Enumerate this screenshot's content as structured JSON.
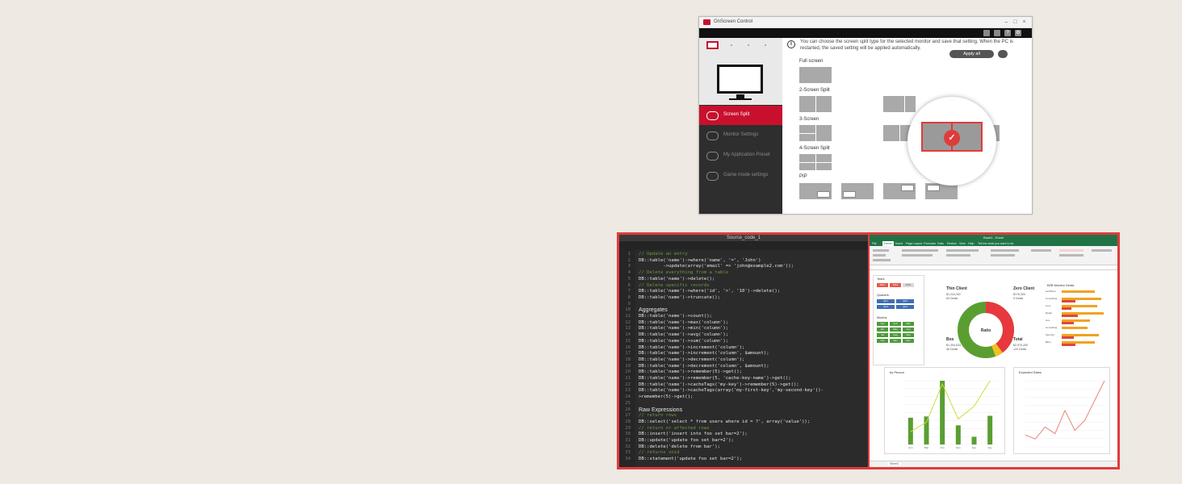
{
  "colors": {
    "lg_red": "#c8102e",
    "highlight_red": "#e03b3b",
    "excel_green": "#217346",
    "donut_green": "#5a9e32",
    "donut_red": "#e8383d",
    "bar_orange": "#f0a31f",
    "bar_red": "#e0453c",
    "line_yellow": "#cddc39"
  },
  "osc": {
    "title": "OnScreen Control",
    "toolbar_icons": [
      "cursor-icon",
      "display-icon",
      "help-icon",
      "gear-icon"
    ],
    "sidebar": [
      {
        "label": "Screen Split",
        "icon": "screen-split-icon"
      },
      {
        "label": "Monitor Settings",
        "icon": "monitor-settings-icon"
      },
      {
        "label": "My Application Preset",
        "icon": "app-preset-icon"
      },
      {
        "label": "Game mode settings",
        "icon": "gamepad-icon"
      }
    ],
    "info_text": "You can choose the screen split type for the selected monitor and save that setting. When the PC is restarted, the saved setting will be applied automatically.",
    "apply_label": "Apply all",
    "sections": {
      "full": "Full screen",
      "two": "2-Screen Split",
      "three": "3-Screen",
      "four": "4-Screen Split",
      "pip": "PIP"
    }
  },
  "code": {
    "title": "Source_code_1",
    "lines": [
      {
        "n": "1",
        "t": "// Update an entry",
        "k": "com"
      },
      {
        "n": "2",
        "t": "DB::table('name')->where('name', '=', 'John')",
        "k": "code"
      },
      {
        "n": "3",
        "t": "         ->update(array('email' => 'john@example2.com'));",
        "k": "code"
      },
      {
        "n": "4",
        "t": "// Delete everything from a table",
        "k": "com"
      },
      {
        "n": "5",
        "t": "DB::table('name')->delete();",
        "k": "code"
      },
      {
        "n": "6",
        "t": "// Delete specific records",
        "k": "com"
      },
      {
        "n": "7",
        "t": "DB::table('name')->where('id', '>', '10')->delete();",
        "k": "code"
      },
      {
        "n": "8",
        "t": "DB::table('name')->truncate();",
        "k": "code"
      },
      {
        "n": "9",
        "t": "",
        "k": "code"
      },
      {
        "n": "10",
        "t": "Aggregates",
        "k": "head"
      },
      {
        "n": "11",
        "t": "DB::table('name')->count();",
        "k": "code"
      },
      {
        "n": "12",
        "t": "DB::table('name')->max('column');",
        "k": "code"
      },
      {
        "n": "13",
        "t": "DB::table('name')->min('column');",
        "k": "code"
      },
      {
        "n": "14",
        "t": "DB::table('name')->avg('column');",
        "k": "code"
      },
      {
        "n": "15",
        "t": "DB::table('name')->sum('column');",
        "k": "code"
      },
      {
        "n": "16",
        "t": "DB::table('name')->increment('column');",
        "k": "code"
      },
      {
        "n": "17",
        "t": "DB::table('name')->increment('column', $amount);",
        "k": "code"
      },
      {
        "n": "18",
        "t": "DB::table('name')->decrement('column');",
        "k": "code"
      },
      {
        "n": "19",
        "t": "DB::table('name')->decrement('column', $amount);",
        "k": "code"
      },
      {
        "n": "20",
        "t": "DB::table('name')->remember(5)->get();",
        "k": "code"
      },
      {
        "n": "21",
        "t": "DB::table('name')->remember(5, 'cache-key-name')->get();",
        "k": "code"
      },
      {
        "n": "22",
        "t": "DB::table('name')->cacheTags('my-key')->remember(5)->get();",
        "k": "code"
      },
      {
        "n": "23",
        "t": "DB::table('name')->cacheTags(array('my-first-key','my-second-key'))-",
        "k": "code"
      },
      {
        "n": "24",
        "t": ">remember(5)->get();",
        "k": "code"
      },
      {
        "n": "25",
        "t": "",
        "k": "code"
      },
      {
        "n": "26",
        "t": "Raw Expressions",
        "k": "head"
      },
      {
        "n": "27",
        "t": "// return rows",
        "k": "com"
      },
      {
        "n": "28",
        "t": "DB::select('select * from users where id = ?', array('value'));",
        "k": "code"
      },
      {
        "n": "29",
        "t": "// return nr affected rows",
        "k": "com"
      },
      {
        "n": "30",
        "t": "DB::insert('insert into foo set bar=2');",
        "k": "code"
      },
      {
        "n": "31",
        "t": "DB::update('update foo set bar=2');",
        "k": "code"
      },
      {
        "n": "32",
        "t": "DB::delete('delete from bar');",
        "k": "code"
      },
      {
        "n": "33",
        "t": "// returns void",
        "k": "com"
      },
      {
        "n": "34",
        "t": "DB::statement('update foo set bar=2');",
        "k": "code"
      }
    ]
  },
  "excel": {
    "title": "Book1 - Excel",
    "tabs": [
      "File",
      "Home",
      "Insert",
      "Page Layout",
      "Formulas",
      "Data",
      "Review",
      "View",
      "Help",
      "Tell me what you want to do"
    ],
    "slicers": [
      {
        "title": "Years",
        "items": [
          "2011",
          "2012",
          "2013"
        ]
      },
      {
        "title": "Quarters",
        "items": [
          "Qtr1",
          "Qtr2",
          "Qtr3",
          "Qtr4"
        ]
      },
      {
        "title": "Months",
        "items": [
          "Jan",
          "Feb",
          "Mar",
          "Apr",
          "May",
          "Jun",
          "Jul",
          "Aug",
          "Sep",
          "Oct",
          "Nov",
          "Dec"
        ]
      }
    ],
    "kpis": [
      {
        "title": "Thin Client",
        "value": "$1,244,302",
        "sub": "63 Deals"
      },
      {
        "title": "Zero Client",
        "value": "$176,300",
        "sub": "9 Deals"
      },
      {
        "title": "Box",
        "value": "$1,354,633",
        "sub": "46 Deals"
      },
      {
        "title": "Total",
        "value": "$2,575,250",
        "sub": "120 Deals"
      }
    ],
    "donut_label": "Ratio",
    "monitor_deals_title": "B2B Monitor Deals",
    "monitor_deals": [
      {
        "label": "webStore",
        "a": 0.7,
        "b": 0.0
      },
      {
        "label": "Consulting",
        "a": 0.85,
        "b": 0.3
      },
      {
        "label": "Cem",
        "a": 0.75,
        "b": 0.2
      },
      {
        "label": "Retail",
        "a": 0.9,
        "b": 0.35
      },
      {
        "label": "Gov",
        "a": 0.6,
        "b": 0.25
      },
      {
        "label": "Consulting",
        "a": 0.55,
        "b": 0.0
      },
      {
        "label": "Security",
        "a": 0.8,
        "b": 0.25
      },
      {
        "label": "Bkml",
        "a": 0.7,
        "b": 0.3
      }
    ],
    "chart1": {
      "title": "by Person",
      "legend": [
        "Amount",
        "Deals"
      ],
      "categories": [
        "Ann",
        "Bob",
        "Cho",
        "Dan",
        "Eve",
        "Fay"
      ],
      "bars": [
        42,
        44,
        100,
        30,
        12,
        45
      ],
      "line": [
        20,
        35,
        95,
        40,
        60,
        100
      ],
      "ymax": 100
    },
    "chart2": {
      "title": "Expected Sales",
      "legend": [
        "Amount"
      ],
      "values": [
        18,
        12,
        30,
        20,
        55,
        25,
        40,
        70,
        100
      ],
      "ymax": 100
    },
    "sheet_tab": "Sheet1"
  }
}
